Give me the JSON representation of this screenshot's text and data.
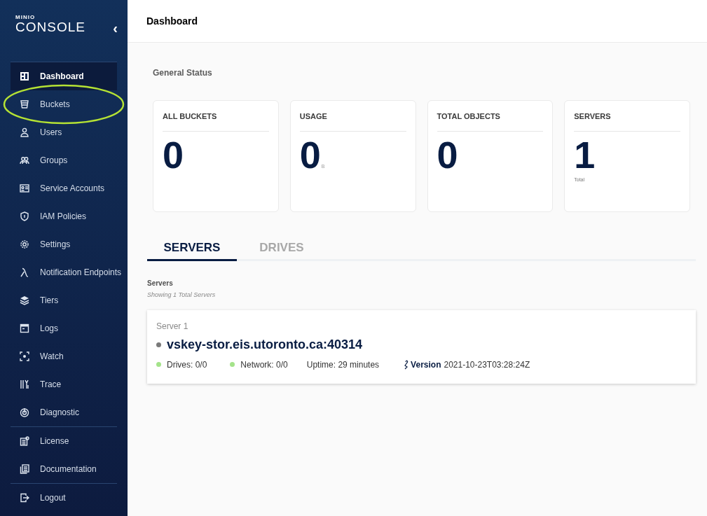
{
  "sidebar": {
    "logo_top": "MINIO",
    "logo_bottom": "CONSOLE",
    "collapse": "‹",
    "sections": [
      [
        {
          "kind": "dashboard",
          "label": "Dashboard",
          "selected": true
        },
        {
          "kind": "buckets",
          "label": "Buckets",
          "selected": false
        },
        {
          "kind": "users",
          "label": "Users",
          "selected": false
        },
        {
          "kind": "groups",
          "label": "Groups",
          "selected": false
        },
        {
          "kind": "accounts",
          "label": "Service Accounts",
          "selected": false
        },
        {
          "kind": "policies",
          "label": "IAM Policies",
          "selected": false
        },
        {
          "kind": "settings",
          "label": "Settings",
          "selected": false
        },
        {
          "kind": "lambda",
          "label": "Notification Endpoints",
          "selected": false
        },
        {
          "kind": "tiers",
          "label": "Tiers",
          "selected": false
        },
        {
          "kind": "logs",
          "label": "Logs",
          "selected": false
        },
        {
          "kind": "watch",
          "label": "Watch",
          "selected": false
        },
        {
          "kind": "trace",
          "label": "Trace",
          "selected": false
        },
        {
          "kind": "diagnostic",
          "label": "Diagnostic",
          "selected": false
        }
      ],
      [
        {
          "kind": "license",
          "label": "License",
          "selected": false
        },
        {
          "kind": "docs",
          "label": "Documentation",
          "selected": false
        }
      ],
      [
        {
          "kind": "logout",
          "label": "Logout",
          "selected": false
        }
      ]
    ]
  },
  "header": {
    "title": "Dashboard"
  },
  "general_status": {
    "title": "General Status",
    "cards": [
      {
        "label": "ALL BUCKETS",
        "value": "0"
      },
      {
        "label": "USAGE",
        "value": "0",
        "unit": "B"
      },
      {
        "label": "TOTAL OBJECTS",
        "value": "0"
      },
      {
        "label": "SERVERS",
        "value": "1",
        "caption": "Total"
      }
    ]
  },
  "tabs": [
    {
      "label": "SERVERS",
      "selected": true
    },
    {
      "label": "DRIVES",
      "selected": false
    }
  ],
  "servers": {
    "title": "Servers",
    "subtitle": "Showing 1 Total Servers",
    "items": [
      {
        "name": "Server 1",
        "host": "vskey-stor.eis.utoronto.ca:40314",
        "drives": "Drives: 0/0",
        "network": "Network: 0/0",
        "uptime": "Uptime: 29 minutes",
        "version_label": "Version",
        "version": "2021-10-23T03:28:24Z"
      }
    ]
  }
}
